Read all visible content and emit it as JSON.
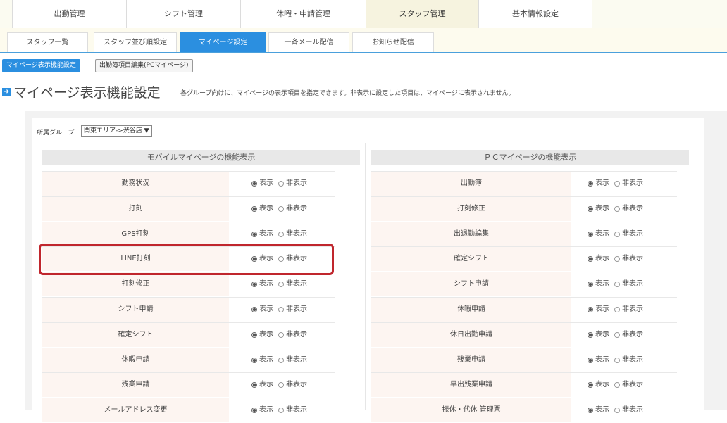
{
  "topnav": [
    "出勤管理",
    "シフト管理",
    "休暇・申請管理",
    "スタッフ管理",
    "基本情報設定"
  ],
  "subnav": [
    "スタッフ一覧",
    "スタッフ並び順設定",
    "マイページ設定",
    "一斉メール配信",
    "お知らせ配信"
  ],
  "buttons": {
    "display_settings": "マイページ表示機能設定",
    "attendance_edit": "出勤簿項目編集(PCマイページ)"
  },
  "heading": {
    "title": "マイページ表示機能設定",
    "description": "各グループ向けに、マイページの表示項目を指定できます。非表示に設定した項目は、マイページに表示されません。"
  },
  "group": {
    "label": "所属グループ",
    "selected": "関東エリア->渋谷店 ▼"
  },
  "options": {
    "show": "表示",
    "hide": "非表示"
  },
  "mobile": {
    "title": "モバイルマイページの機能表示",
    "rows": [
      "勤務状況",
      "打刻",
      "GPS打刻",
      "LINE打刻",
      "打刻修正",
      "シフト申請",
      "確定シフト",
      "休暇申請",
      "残業申請",
      "メールアドレス変更"
    ]
  },
  "pc": {
    "title": "ＰＣマイページの機能表示",
    "rows": [
      "出勤簿",
      "打刻修正",
      "出退勤編集",
      "確定シフト",
      "シフト申請",
      "休暇申請",
      "休日出勤申請",
      "残業申請",
      "早出残業申請",
      "振休・代休 管理票"
    ]
  },
  "colors": {
    "accent": "#2b8fe0",
    "highlight": "#c0262d",
    "row_label_bg": "#fdf5f1"
  }
}
